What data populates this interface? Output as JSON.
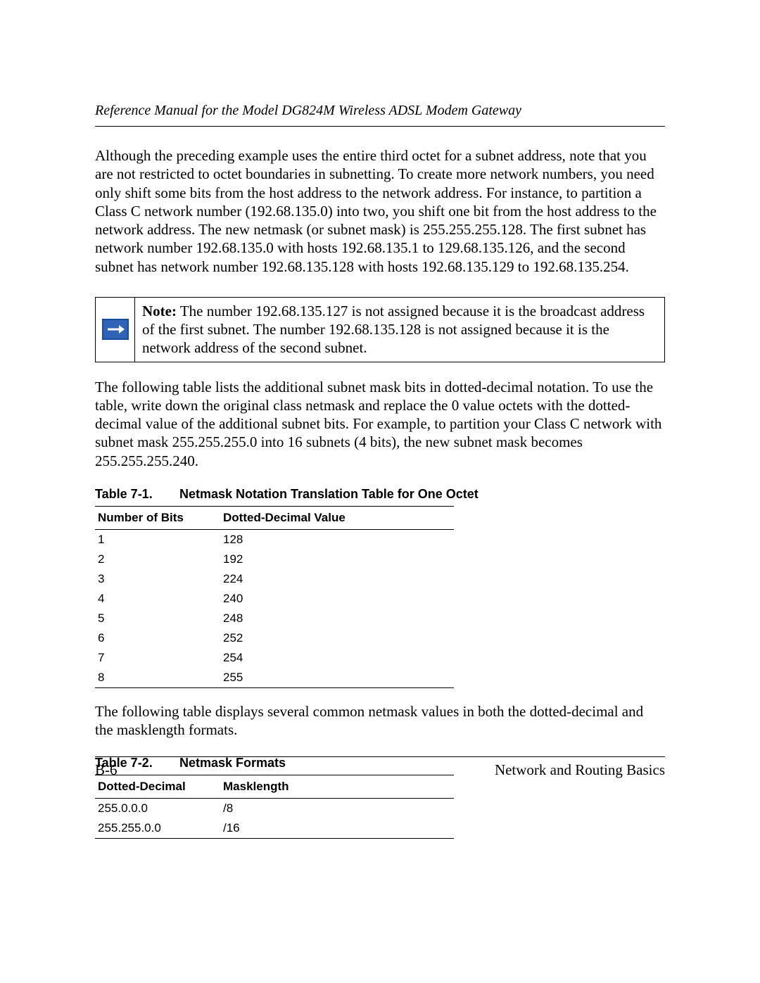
{
  "header": {
    "title": "Reference Manual for the Model DG824M Wireless ADSL Modem Gateway"
  },
  "paragraphs": {
    "p1": "Although the preceding example uses the entire third octet for a subnet address, note that you are not restricted to octet boundaries in subnetting. To create more network numbers, you need only shift some bits from the host address to the network address. For instance, to partition a Class C network number (192.68.135.0) into two, you shift one bit from the host address to the network address. The new netmask (or subnet mask) is 255.255.255.128. The first subnet has network number 192.68.135.0 with hosts 192.68.135.1 to 129.68.135.126, and the second subnet has network number 192.68.135.128 with hosts 192.68.135.129 to 192.68.135.254.",
    "p2": "The following table lists the additional subnet mask bits in dotted-decimal notation. To use the table, write down the original class netmask and replace the 0 value octets with the dotted-decimal value of the additional subnet bits. For example, to partition your Class C network with subnet mask 255.255.255.0 into 16 subnets (4 bits), the new subnet mask becomes 255.255.255.240.",
    "p3": "The following table displays several common netmask values in both the dotted-decimal and the masklength formats."
  },
  "note": {
    "label": "Note:",
    "text": " The number 192.68.135.127 is not assigned because it is the broadcast address of the first subnet. The number 192.68.135.128 is not assigned because it is the network address of the second subnet."
  },
  "table1": {
    "caption_no": "Table 7-1.",
    "caption_title": "Netmask Notation Translation Table for One Octet",
    "head_a": "Number of Bits",
    "head_b": "Dotted-Decimal Value",
    "rows": [
      {
        "a": "1",
        "b": "128"
      },
      {
        "a": "2",
        "b": "192"
      },
      {
        "a": "3",
        "b": "224"
      },
      {
        "a": "4",
        "b": "240"
      },
      {
        "a": "5",
        "b": "248"
      },
      {
        "a": "6",
        "b": "252"
      },
      {
        "a": "7",
        "b": "254"
      },
      {
        "a": "8",
        "b": "255"
      }
    ]
  },
  "table2": {
    "caption_no": "Table 7-2.",
    "caption_title": "Netmask Formats",
    "head_a": "Dotted-Decimal",
    "head_b": "Masklength",
    "rows": [
      {
        "a": "255.0.0.0",
        "b": "/8"
      },
      {
        "a": "255.255.0.0",
        "b": "/16"
      }
    ]
  },
  "footer": {
    "left": "B-6",
    "right": "Network and Routing Basics"
  }
}
